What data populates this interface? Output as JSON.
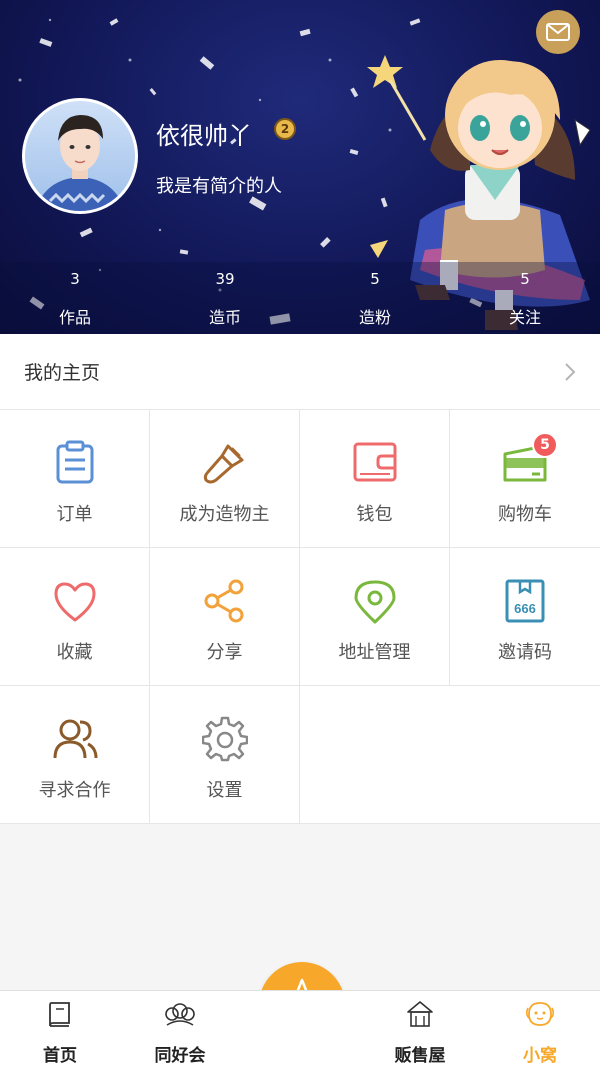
{
  "header": {
    "nickname": "依很帅丫",
    "level": "2",
    "bio": "我是有简介的人",
    "mail_icon": "mail-icon",
    "stats": [
      {
        "value": "3",
        "label": "作品"
      },
      {
        "value": "39",
        "label": "造币"
      },
      {
        "value": "5",
        "label": "造粉"
      },
      {
        "value": "5",
        "label": "关注"
      }
    ]
  },
  "home_row": {
    "label": "我的主页",
    "icon": "chevron-right-icon"
  },
  "grid": [
    {
      "label": "订单",
      "icon": "clipboard-icon",
      "color": "#5b8fd6"
    },
    {
      "label": "成为造物主",
      "icon": "brush-icon",
      "color": "#a8692e"
    },
    {
      "label": "钱包",
      "icon": "wallet-icon",
      "color": "#ef6b6b"
    },
    {
      "label": "购物车",
      "icon": "cart-icon",
      "color": "#79b83c",
      "badge": "5"
    },
    {
      "label": "收藏",
      "icon": "heart-icon",
      "color": "#ef6b6b"
    },
    {
      "label": "分享",
      "icon": "share-icon",
      "color": "#f2a23a"
    },
    {
      "label": "地址管理",
      "icon": "location-icon",
      "color": "#79b83c"
    },
    {
      "label": "邀请码",
      "icon": "invite-code-icon",
      "color": "#3a8fb5",
      "code": "666"
    },
    {
      "label": "寻求合作",
      "icon": "users-icon",
      "color": "#8a5a2b"
    },
    {
      "label": "设置",
      "icon": "gear-icon",
      "color": "#888888"
    }
  ],
  "tabbar": {
    "items": [
      {
        "label": "首页",
        "icon": "book-icon"
      },
      {
        "label": "同好会",
        "icon": "group-icon"
      },
      {
        "label": "贩售屋",
        "icon": "shop-icon"
      },
      {
        "label": "小窝",
        "icon": "nest-icon"
      }
    ],
    "active": "小窝",
    "accent": "#f7a82a",
    "create_icon": "create-pen-icon"
  }
}
